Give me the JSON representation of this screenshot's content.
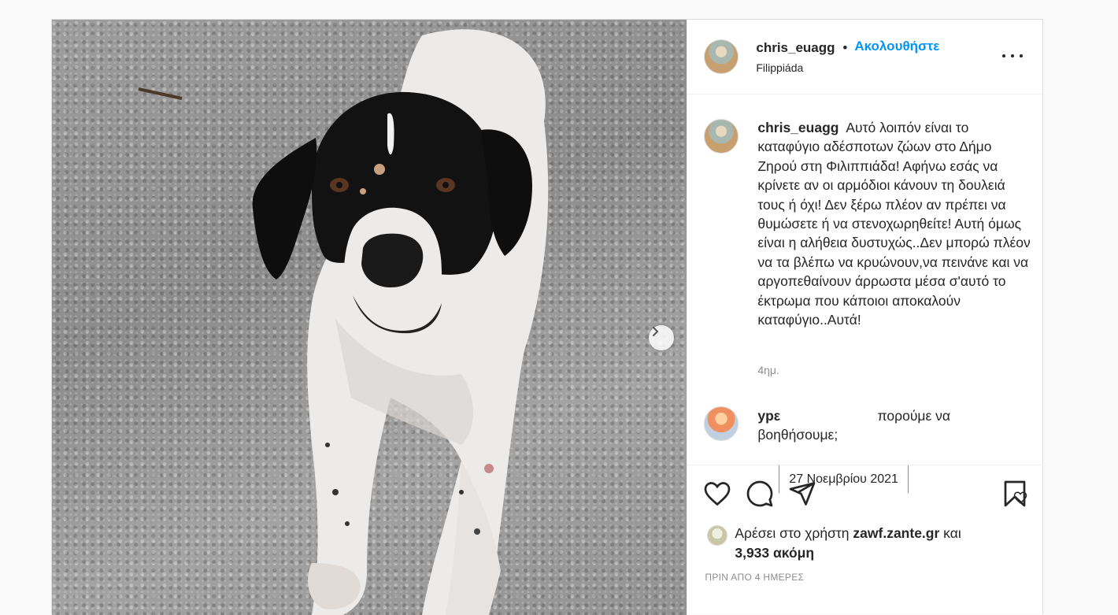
{
  "post": {
    "author": {
      "username": "chris_euagg",
      "follow_label": "Ακολουθήστε",
      "separator": "•",
      "location": "Filippiáda"
    },
    "caption": {
      "username": "chris_euagg",
      "text": "Αυτό λοιπόν είναι το καταφύγιο αδέσποτων ζώων στο Δήμο Ζηρού στη Φιλιππιάδα! Αφήνω εσάς να κρίνετε αν οι αρμόδιοι κάνουν τη δουλειά τους ή όχι! Δεν ξέρω πλέον αν πρέπει να θυμώσετε ή να στενοχωρηθείτε! Αυτή όμως είναι η αλήθεια δυστυχώς..Δεν μπορώ πλέον να τα βλέπω να κρυώνουν,να πεινάνε και να αργοπεθαίνουν άρρωστα μέσα σ'αυτό το έκτρωμα που κάποιοι αποκαλούν καταφύγιο..Αυτά!",
      "time_ago": "4ημ."
    },
    "tooltip": "27 Νοεμβρίου 2021",
    "comment": {
      "username": "ypε",
      "text_visible_tail": "πορούμε να βοηθήσουμε;"
    },
    "likes": {
      "prefix": "Αρέσει στο χρήστη",
      "user": "zawf.zante.gr",
      "conjunction": "και",
      "count": "3,933 ακόμη"
    },
    "posted_date": "ΠΡΙΝ ΑΠΟ 4 ΗΜΕΡΕΣ"
  },
  "icons": {
    "like": "heart-icon",
    "comment": "comment-icon",
    "share": "share-icon",
    "save": "bookmark-icon",
    "more": "more-options-icon",
    "next": "chevron-right-icon"
  },
  "colors": {
    "accent": "#0095f6",
    "text": "#262626",
    "muted": "#8e8e8e",
    "border": "#dbdbdb"
  }
}
